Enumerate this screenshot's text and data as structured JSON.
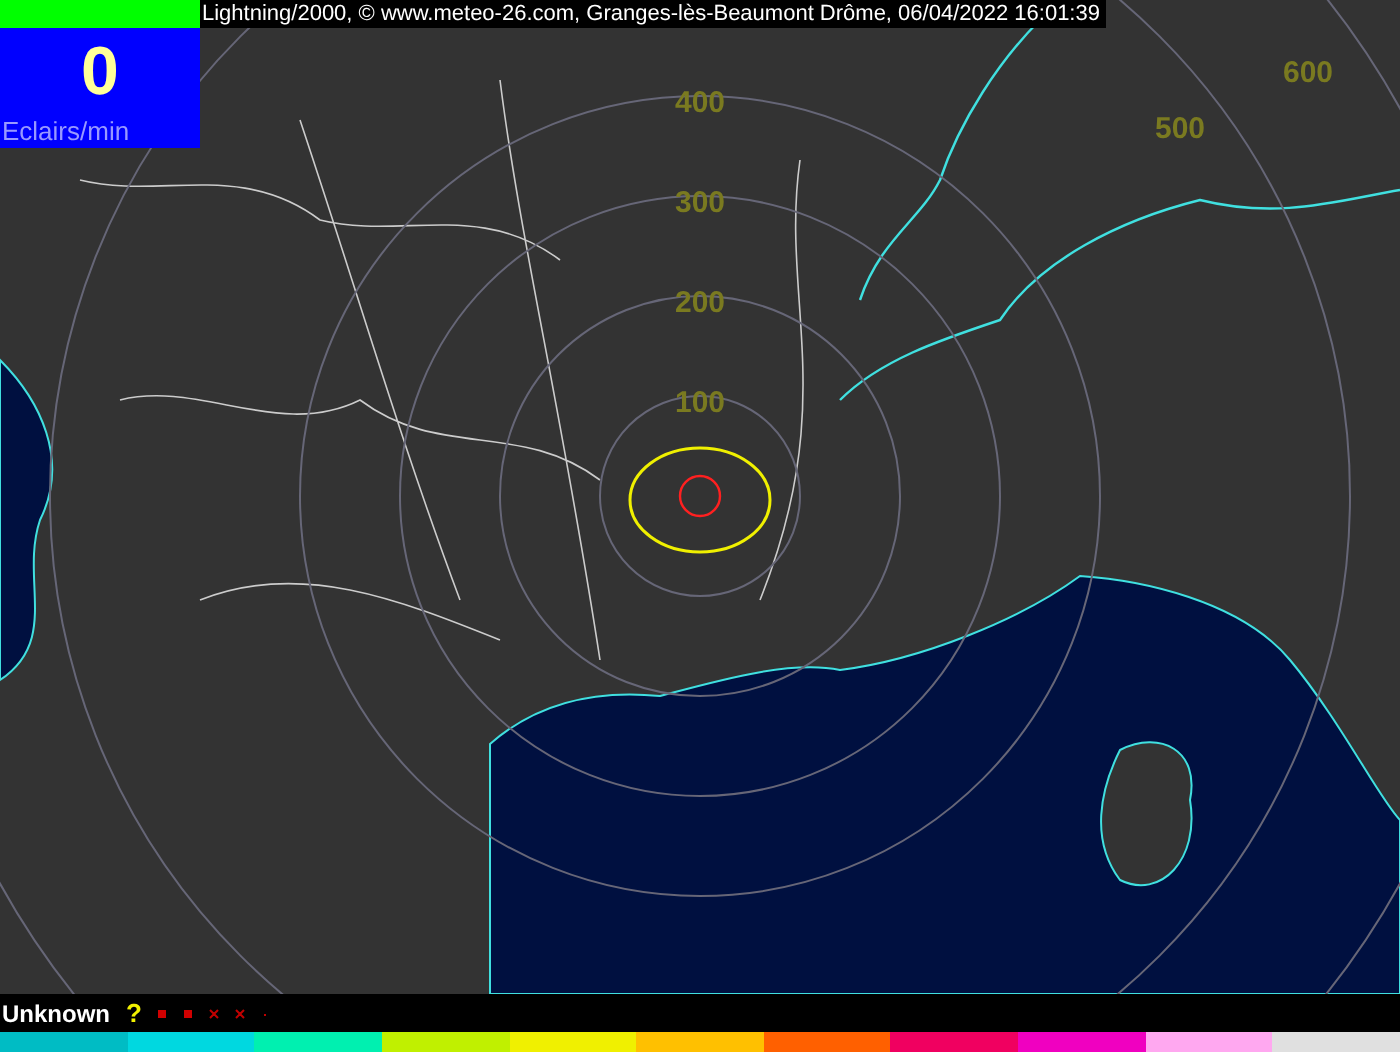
{
  "header": {
    "title": "Lightning/2000, © www.meteo-26.com, Granges-lès-Beaumont Drôme, 06/04/2022 16:01:39"
  },
  "counter": {
    "value": "0",
    "unit": "Eclairs/min"
  },
  "map": {
    "range_labels": [
      {
        "text": "600",
        "kind": "corner"
      },
      {
        "text": "400",
        "kind": "ring"
      },
      {
        "text": "500",
        "kind": "corner"
      },
      {
        "text": "300",
        "kind": "ring"
      },
      {
        "text": "200",
        "kind": "ring"
      },
      {
        "text": "100",
        "kind": "ring"
      }
    ]
  },
  "status_bar": {
    "label": "Unknown",
    "symbol": "?"
  },
  "color_scale": [
    {
      "color": "#00bcc4"
    },
    {
      "color": "#00d8e0"
    },
    {
      "color": "#00f0b0"
    },
    {
      "color": "#c0f000"
    },
    {
      "color": "#f0f000"
    },
    {
      "color": "#ffc000"
    },
    {
      "color": "#ff6000"
    },
    {
      "color": "#f00060"
    },
    {
      "color": "#f000c0"
    },
    {
      "color": "#ffa8f0"
    },
    {
      "color": "#e0e0e0"
    }
  ]
}
